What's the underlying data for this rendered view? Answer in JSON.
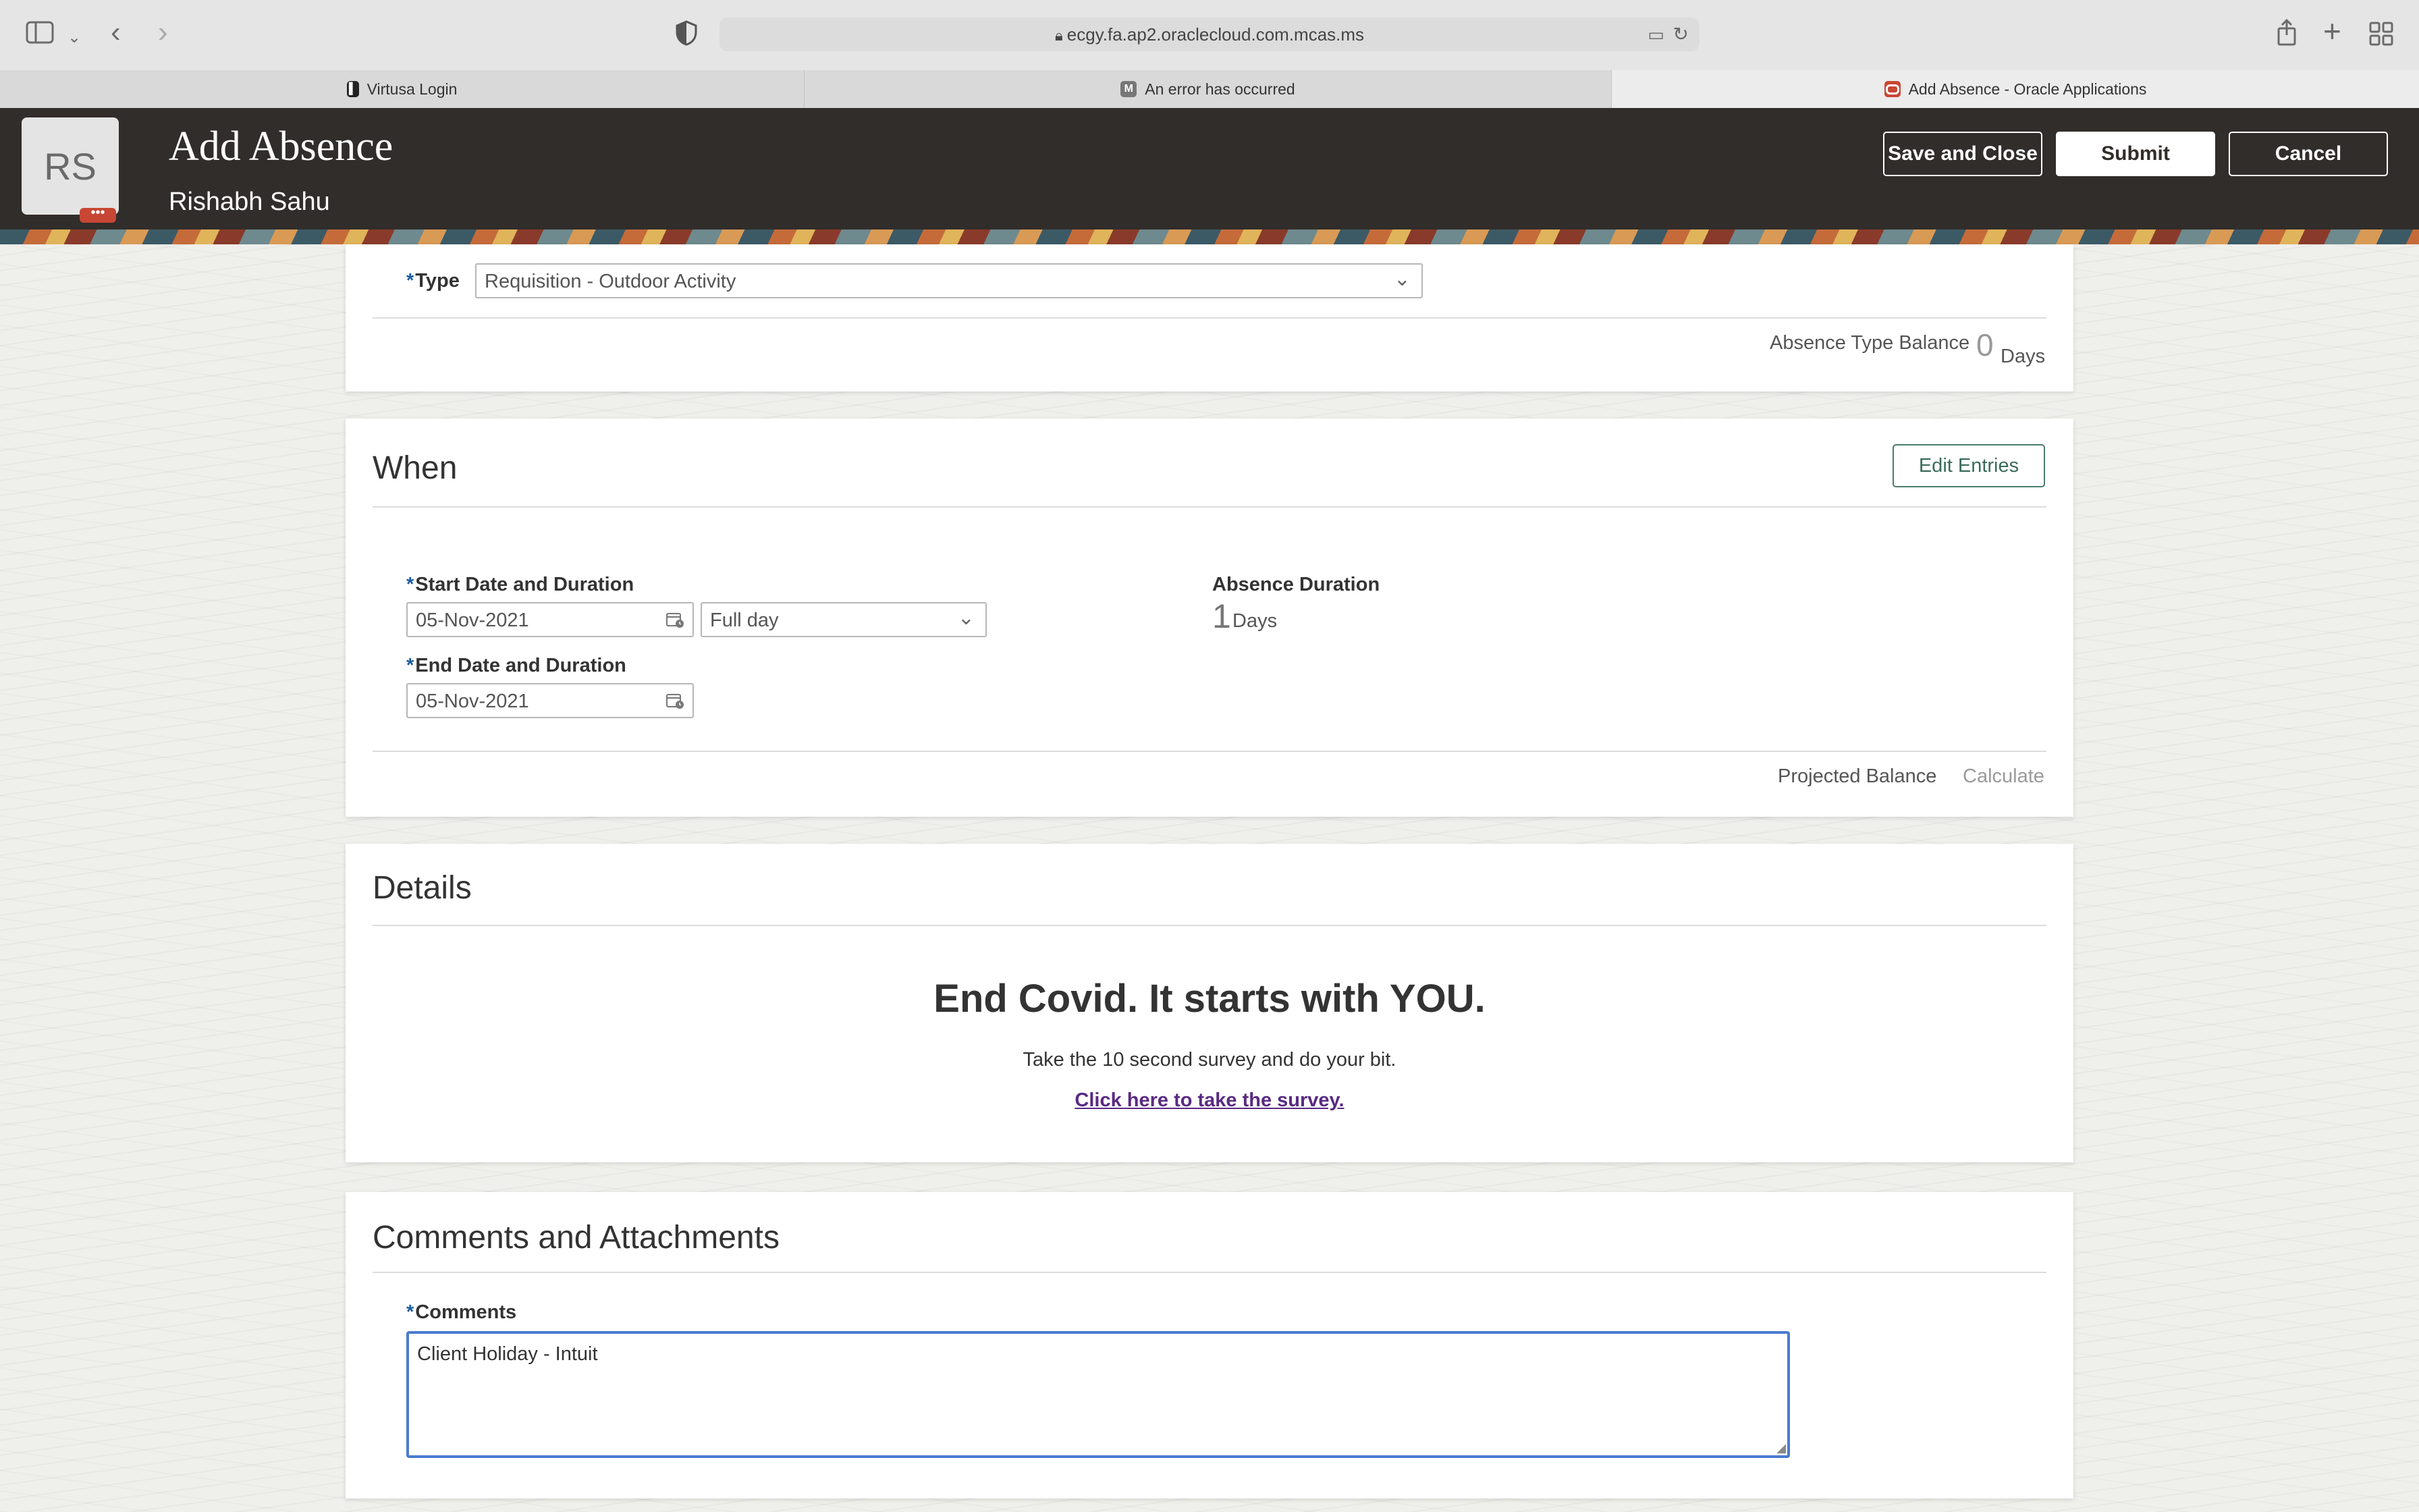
{
  "browser": {
    "url": "ecgy.fa.ap2.oraclecloud.com.mcas.ms",
    "tabs": [
      {
        "label": "Virtusa Login"
      },
      {
        "label": "An error has occurred"
      },
      {
        "label": "Add Absence - Oracle Applications"
      }
    ]
  },
  "header": {
    "avatar_initials": "RS",
    "title": "Add Absence",
    "person": "Rishabh Sahu",
    "save_close": "Save and Close",
    "submit": "Submit",
    "cancel": "Cancel"
  },
  "type_section": {
    "required_mark": "*",
    "type_label": "Type",
    "type_value": "Requisition - Outdoor Activity",
    "balance_label": "Absence Type Balance",
    "balance_value": "0",
    "balance_unit": "Days"
  },
  "when": {
    "title": "When",
    "edit_entries": "Edit Entries",
    "start_label": "Start Date and Duration",
    "start_date": "05-Nov-2021",
    "start_duration": "Full day",
    "end_label": "End Date and Duration",
    "end_date": "05-Nov-2021",
    "absence_duration_label": "Absence Duration",
    "absence_duration_value": "1",
    "absence_duration_unit": "Days",
    "projected_balance": "Projected Balance",
    "calculate": "Calculate"
  },
  "details": {
    "title": "Details",
    "headline": "End Covid. It starts with YOU.",
    "subtext": "Take the 10 second survey and do your bit.",
    "link": "Click here to take the survey."
  },
  "comments": {
    "title": "Comments and Attachments",
    "label": "Comments",
    "value": "Client Holiday - Intuit"
  },
  "colors": {
    "header_bg": "#312d2a",
    "required": "#1b5c9e",
    "link": "#5a2a82",
    "focus": "#4a7bd0"
  }
}
